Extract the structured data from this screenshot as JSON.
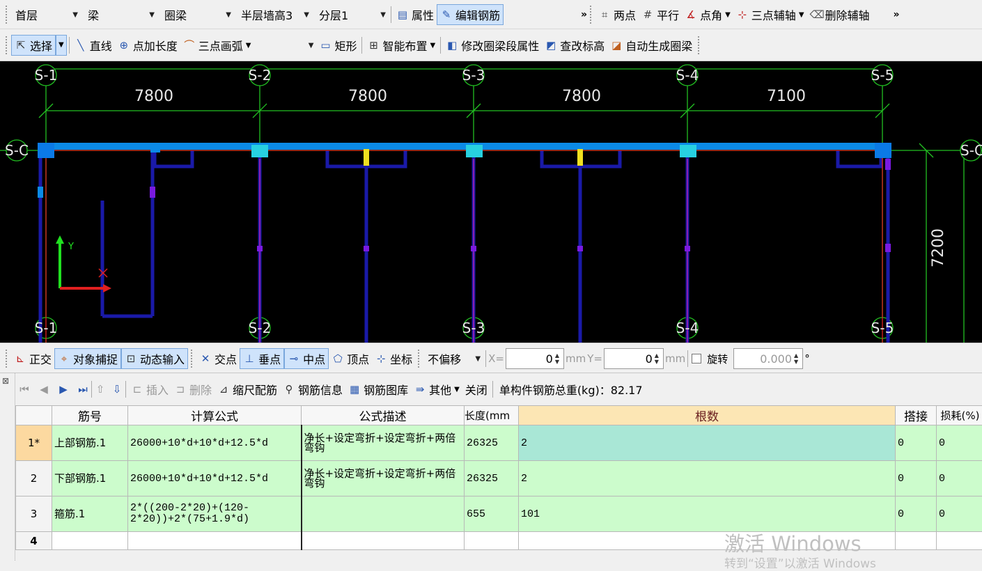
{
  "toolbar1": {
    "floor": "首层",
    "component": "梁",
    "type": "圈梁",
    "wall": "半层墙高3",
    "layer": "分层1",
    "property": "属性",
    "edit_rebar": "编辑钢筋",
    "more": "»",
    "two_points": "两点",
    "parallel": "平行",
    "point_angle": "点角",
    "three_point_axis": "三点辅轴",
    "delete_axis": "删除辅轴",
    "more2": "»"
  },
  "toolbar2": {
    "select": "选择",
    "line": "直线",
    "point_length": "点加长度",
    "three_point_arc": "三点画弧",
    "rect": "矩形",
    "smart": "智能布置",
    "modify_segment": "修改圈梁段属性",
    "check_elev": "查改标高",
    "auto_generate": "自动生成圈梁"
  },
  "canvas": {
    "axes_top": [
      "S-1",
      "S-2",
      "S-3",
      "S-4",
      "S-5"
    ],
    "axes_bottom": [
      "S-1",
      "S-2",
      "S-3",
      "S-4",
      "S-5"
    ],
    "axis_left": "S-C",
    "axis_right": "S-C",
    "dims": [
      "7800",
      "7800",
      "7800",
      "7100"
    ],
    "dim_vertical": "7200",
    "ucs_x": "X",
    "ucs_y": "Y"
  },
  "toolbar3": {
    "ortho": "正交",
    "snap": "对象捕捉",
    "dynamic": "动态输入",
    "intersect": "交点",
    "perp": "垂点",
    "mid": "中点",
    "vertex": "顶点",
    "coord": "坐标",
    "offset": "不偏移",
    "x_label": "X=",
    "x_value": "0",
    "mm1": "mm",
    "y_label": "Y=",
    "y_value": "0",
    "mm2": "mm",
    "rotate": "旋转",
    "rotate_value": "0.000",
    "deg": "°"
  },
  "toolbar4": {
    "insert": "插入",
    "delete": "删除",
    "scale_rebar": "缩尺配筋",
    "rebar_info": "钢筋信息",
    "rebar_lib": "钢筋图库",
    "other": "其他",
    "close": "关闭",
    "total": "单构件钢筋总重(kg)：82.17"
  },
  "table": {
    "headers": [
      "筋号",
      "计算公式",
      "公式描述",
      "长度(mm",
      "根数",
      "搭接",
      "损耗(%)"
    ],
    "rows": [
      {
        "num": "1*",
        "name": "上部钢筋.1",
        "formula": "26000+10*d+10*d+12.5*d",
        "desc": "净长+设定弯折+设定弯折+两倍弯钩",
        "length": "26325",
        "count": "2",
        "lap": "0",
        "loss": "0"
      },
      {
        "num": "2",
        "name": "下部钢筋.1",
        "formula": "26000+10*d+10*d+12.5*d",
        "desc": "净长+设定弯折+设定弯折+两倍弯钩",
        "length": "26325",
        "count": "2",
        "lap": "0",
        "loss": "0"
      },
      {
        "num": "3",
        "name": "箍筋.1",
        "formula": "2*((200-2*20)+(120-2*20))+2*(75+1.9*d)",
        "desc": "",
        "length": "655",
        "count": "101",
        "lap": "0",
        "loss": "0"
      }
    ],
    "empty_row": "4"
  },
  "watermark": {
    "line1": "激活 Windows",
    "line2": "转到“设置”以激活 Windows"
  }
}
